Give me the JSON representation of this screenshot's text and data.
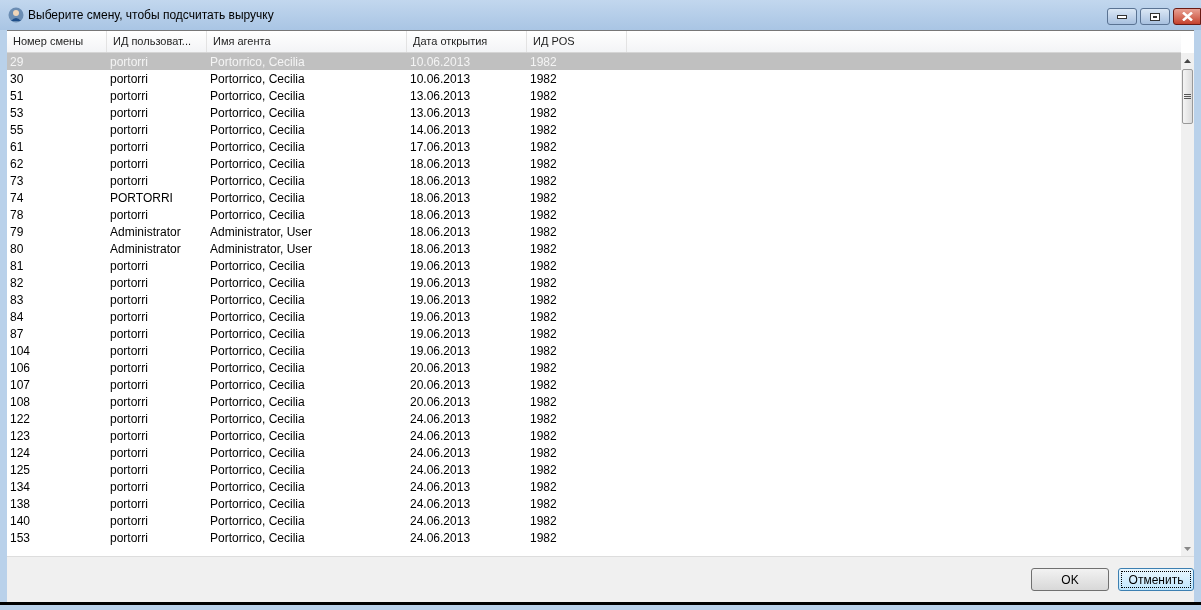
{
  "window": {
    "title": "Выберите смену, чтобы подсчитать выручку"
  },
  "table": {
    "columns": [
      "Номер смены",
      "ИД пользоват...",
      "Имя агента",
      "Дата открытия",
      "ИД POS"
    ],
    "rows": [
      {
        "cells": [
          "29",
          "portorri",
          "Portorrico, Cecilia",
          "10.06.2013",
          "1982"
        ],
        "selected": true
      },
      {
        "cells": [
          "30",
          "portorri",
          "Portorrico, Cecilia",
          "10.06.2013",
          "1982"
        ],
        "selected": false
      },
      {
        "cells": [
          "51",
          "portorri",
          "Portorrico, Cecilia",
          "13.06.2013",
          "1982"
        ],
        "selected": false
      },
      {
        "cells": [
          "53",
          "portorri",
          "Portorrico, Cecilia",
          "13.06.2013",
          "1982"
        ],
        "selected": false
      },
      {
        "cells": [
          "55",
          "portorri",
          "Portorrico, Cecilia",
          "14.06.2013",
          "1982"
        ],
        "selected": false
      },
      {
        "cells": [
          "61",
          "portorri",
          "Portorrico, Cecilia",
          "17.06.2013",
          "1982"
        ],
        "selected": false
      },
      {
        "cells": [
          "62",
          "portorri",
          "Portorrico, Cecilia",
          "18.06.2013",
          "1982"
        ],
        "selected": false
      },
      {
        "cells": [
          "73",
          "portorri",
          "Portorrico, Cecilia",
          "18.06.2013",
          "1982"
        ],
        "selected": false
      },
      {
        "cells": [
          "74",
          "PORTORRI",
          "Portorrico, Cecilia",
          "18.06.2013",
          "1982"
        ],
        "selected": false
      },
      {
        "cells": [
          "78",
          "portorri",
          "Portorrico, Cecilia",
          "18.06.2013",
          "1982"
        ],
        "selected": false
      },
      {
        "cells": [
          "79",
          "Administrator",
          "Administrator, User",
          "18.06.2013",
          "1982"
        ],
        "selected": false
      },
      {
        "cells": [
          "80",
          "Administrator",
          "Administrator, User",
          "18.06.2013",
          "1982"
        ],
        "selected": false
      },
      {
        "cells": [
          "81",
          "portorri",
          "Portorrico, Cecilia",
          "19.06.2013",
          "1982"
        ],
        "selected": false
      },
      {
        "cells": [
          "82",
          "portorri",
          "Portorrico, Cecilia",
          "19.06.2013",
          "1982"
        ],
        "selected": false
      },
      {
        "cells": [
          "83",
          "portorri",
          "Portorrico, Cecilia",
          "19.06.2013",
          "1982"
        ],
        "selected": false
      },
      {
        "cells": [
          "84",
          "portorri",
          "Portorrico, Cecilia",
          "19.06.2013",
          "1982"
        ],
        "selected": false
      },
      {
        "cells": [
          "87",
          "portorri",
          "Portorrico, Cecilia",
          "19.06.2013",
          "1982"
        ],
        "selected": false
      },
      {
        "cells": [
          "104",
          "portorri",
          "Portorrico, Cecilia",
          "19.06.2013",
          "1982"
        ],
        "selected": false
      },
      {
        "cells": [
          "106",
          "portorri",
          "Portorrico, Cecilia",
          "20.06.2013",
          "1982"
        ],
        "selected": false
      },
      {
        "cells": [
          "107",
          "portorri",
          "Portorrico, Cecilia",
          "20.06.2013",
          "1982"
        ],
        "selected": false
      },
      {
        "cells": [
          "108",
          "portorri",
          "Portorrico, Cecilia",
          "20.06.2013",
          "1982"
        ],
        "selected": false
      },
      {
        "cells": [
          "122",
          "portorri",
          "Portorrico, Cecilia",
          "24.06.2013",
          "1982"
        ],
        "selected": false
      },
      {
        "cells": [
          "123",
          "portorri",
          "Portorrico, Cecilia",
          "24.06.2013",
          "1982"
        ],
        "selected": false
      },
      {
        "cells": [
          "124",
          "portorri",
          "Portorrico, Cecilia",
          "24.06.2013",
          "1982"
        ],
        "selected": false
      },
      {
        "cells": [
          "125",
          "portorri",
          "Portorrico, Cecilia",
          "24.06.2013",
          "1982"
        ],
        "selected": false
      },
      {
        "cells": [
          "134",
          "portorri",
          "Portorrico, Cecilia",
          "24.06.2013",
          "1982"
        ],
        "selected": false
      },
      {
        "cells": [
          "138",
          "portorri",
          "Portorrico, Cecilia",
          "24.06.2013",
          "1982"
        ],
        "selected": false
      },
      {
        "cells": [
          "140",
          "portorri",
          "Portorrico, Cecilia",
          "24.06.2013",
          "1982"
        ],
        "selected": false
      },
      {
        "cells": [
          "153",
          "portorri",
          "Portorrico, Cecilia",
          "24.06.2013",
          "1982"
        ],
        "selected": false
      }
    ]
  },
  "buttons": [
    "OK",
    "Отменить"
  ]
}
